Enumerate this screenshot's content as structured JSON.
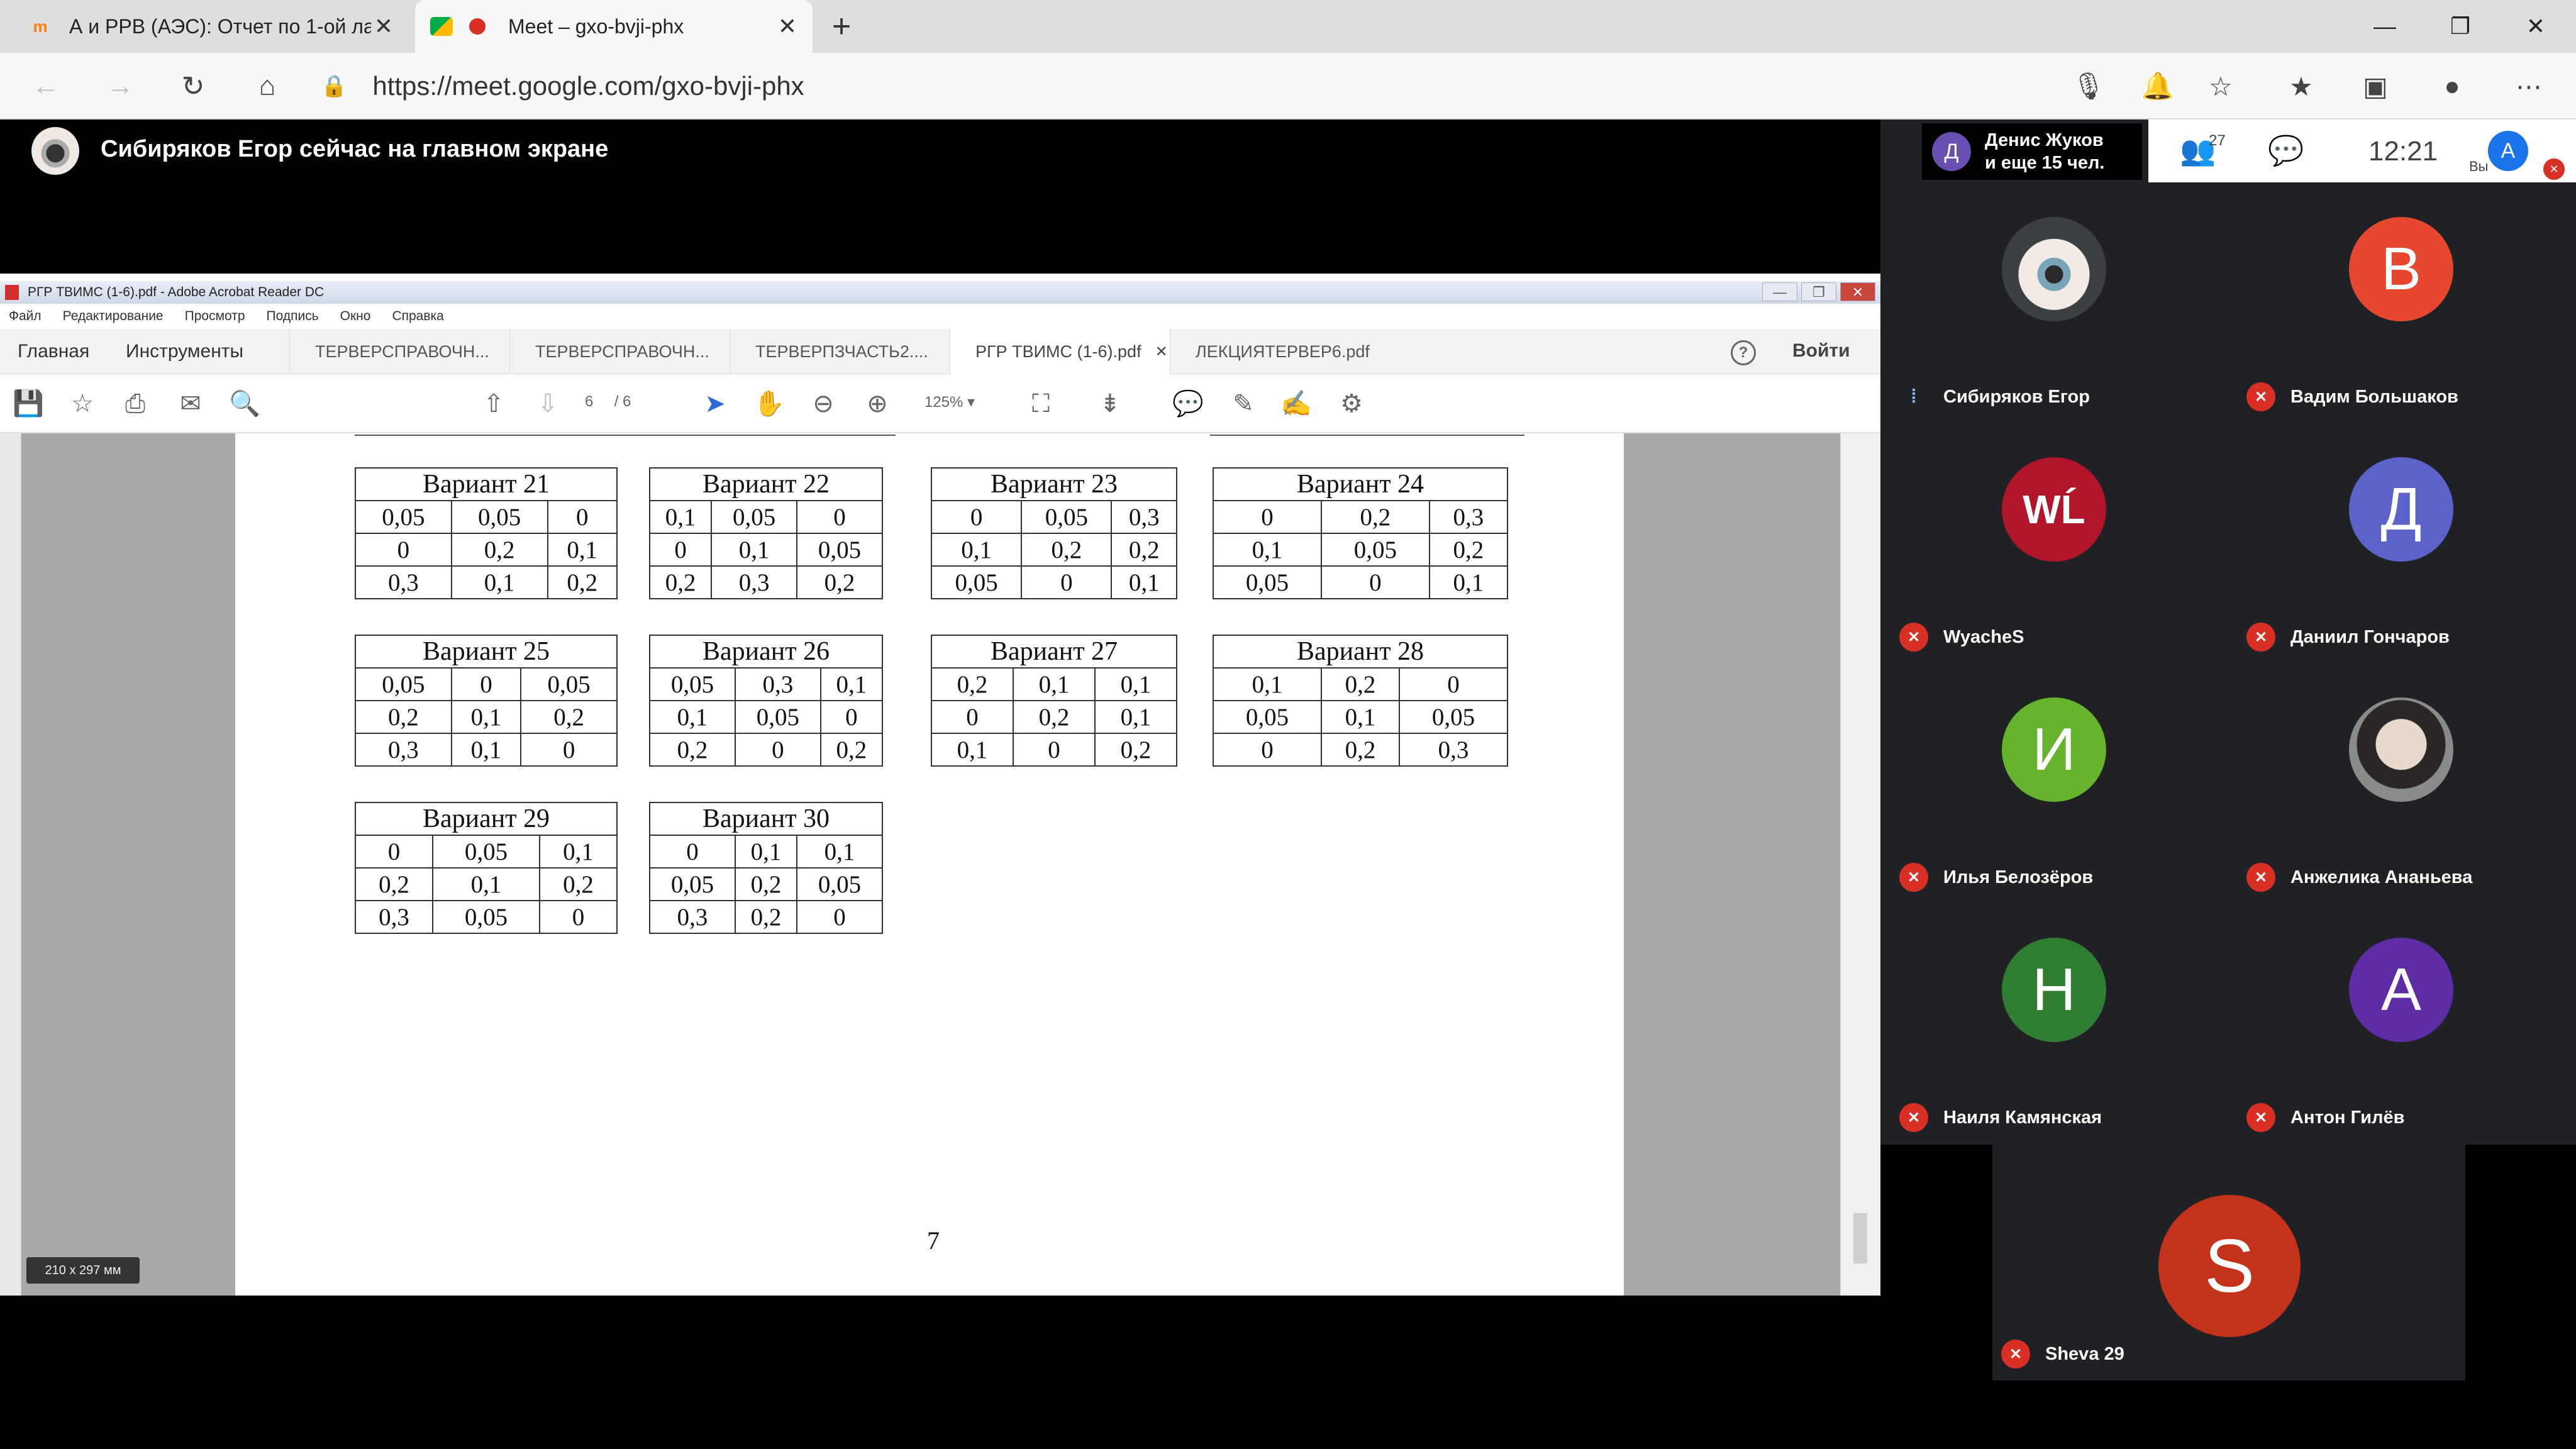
{
  "browser": {
    "tabs": [
      {
        "title": "А и РРВ (АЭС): Отчет по 1-ой ла",
        "active": false
      },
      {
        "title": "Meet – gxo-bvji-phx",
        "active": true
      }
    ],
    "new_tab": "+",
    "url": "https://meet.google.com/gxo-bvji-phx",
    "window_controls": {
      "minimize": "—",
      "maximize": "❐",
      "close": "✕"
    }
  },
  "meet": {
    "presenter_banner": "Сибиряков Егор сейчас на главном экране",
    "notification": {
      "initial": "Д",
      "line1": "Денис Жуков",
      "line2": "и еще 15 чел."
    },
    "participant_count": "27",
    "clock": "12:21",
    "you_label": "Вы",
    "user_initial": "A",
    "participants": [
      {
        "name": "Сибиряков Егор",
        "initial": "",
        "color": "#3c4043",
        "muted": false
      },
      {
        "name": "Вадим Большаков",
        "initial": "В",
        "color": "#e8472f",
        "muted": true
      },
      {
        "name": "WyacheS",
        "initial": "WĹ",
        "color": "#b0152b",
        "muted": true
      },
      {
        "name": "Даниил Гончаров",
        "initial": "Д",
        "color": "#5b63c9",
        "muted": true
      },
      {
        "name": "Илья Белозёров",
        "initial": "И",
        "color": "#66b32e",
        "muted": true
      },
      {
        "name": "Анжелика Ананьева",
        "initial": "",
        "color": "#6b6b6b",
        "muted": true
      },
      {
        "name": "Наиля Камянская",
        "initial": "Н",
        "color": "#2e7d32",
        "muted": true
      },
      {
        "name": "Антон Гилёв",
        "initial": "А",
        "color": "#5e2ca5",
        "muted": true
      }
    ],
    "bottom_participant": {
      "name": "Sheva 29",
      "initial": "S"
    }
  },
  "acrobat": {
    "title": "РГР ТВИМС (1-6).pdf - Adobe Acrobat Reader DC",
    "menu": [
      "Файл",
      "Редактирование",
      "Просмотр",
      "Подпись",
      "Окно",
      "Справка"
    ],
    "home_tab": "Главная",
    "tools_tab": "Инструменты",
    "doc_tabs": [
      "ТЕРВЕРСПРАВОЧН...",
      "ТЕРВЕРСПРАВОЧН...",
      "ТЕРВЕРПЗЧАСТЬ2....",
      "РГР ТВИМС (1-6).pdf",
      "ЛЕКЦИЯТЕРВЕР6.pdf"
    ],
    "active_doc_index": 3,
    "signin": "Войти",
    "help": "?",
    "page_current": "6",
    "page_total": "/ 6",
    "zoom": "125%",
    "page_size": "210 x 297 мм",
    "printed_page_number": "7"
  },
  "variants": [
    {
      "title": "Вариант 21",
      "rows": [
        [
          "0,05",
          "0,05",
          "0"
        ],
        [
          "0",
          "0,2",
          "0,1"
        ],
        [
          "0,3",
          "0,1",
          "0,2"
        ]
      ]
    },
    {
      "title": "Вариант 22",
      "rows": [
        [
          "0,1",
          "0,05",
          "0"
        ],
        [
          "0",
          "0,1",
          "0,05"
        ],
        [
          "0,2",
          "0,3",
          "0,2"
        ]
      ]
    },
    {
      "title": "Вариант 23",
      "rows": [
        [
          "0",
          "0,05",
          "0,3"
        ],
        [
          "0,1",
          "0,2",
          "0,2"
        ],
        [
          "0,05",
          "0",
          "0,1"
        ]
      ]
    },
    {
      "title": "Вариант 24",
      "rows": [
        [
          "0",
          "0,2",
          "0,3"
        ],
        [
          "0,1",
          "0,05",
          "0,2"
        ],
        [
          "0,05",
          "0",
          "0,1"
        ]
      ]
    },
    {
      "title": "Вариант 25",
      "rows": [
        [
          "0,05",
          "0",
          "0,05"
        ],
        [
          "0,2",
          "0,1",
          "0,2"
        ],
        [
          "0,3",
          "0,1",
          "0"
        ]
      ]
    },
    {
      "title": "Вариант 26",
      "rows": [
        [
          "0,05",
          "0,3",
          "0,1"
        ],
        [
          "0,1",
          "0,05",
          "0"
        ],
        [
          "0,2",
          "0",
          "0,2"
        ]
      ]
    },
    {
      "title": "Вариант 27",
      "rows": [
        [
          "0,2",
          "0,1",
          "0,1"
        ],
        [
          "0",
          "0,2",
          "0,1"
        ],
        [
          "0,1",
          "0",
          "0,2"
        ]
      ]
    },
    {
      "title": "Вариант 28",
      "rows": [
        [
          "0,1",
          "0,2",
          "0"
        ],
        [
          "0,05",
          "0,1",
          "0,05"
        ],
        [
          "0",
          "0,2",
          "0,3"
        ]
      ]
    },
    {
      "title": "Вариант 29",
      "rows": [
        [
          "0",
          "0,05",
          "0,1"
        ],
        [
          "0,2",
          "0,1",
          "0,2"
        ],
        [
          "0,3",
          "0,05",
          "0"
        ]
      ]
    },
    {
      "title": "Вариант 30",
      "rows": [
        [
          "0",
          "0,1",
          "0,1"
        ],
        [
          "0,05",
          "0,2",
          "0,05"
        ],
        [
          "0,3",
          "0,2",
          "0"
        ]
      ]
    }
  ]
}
